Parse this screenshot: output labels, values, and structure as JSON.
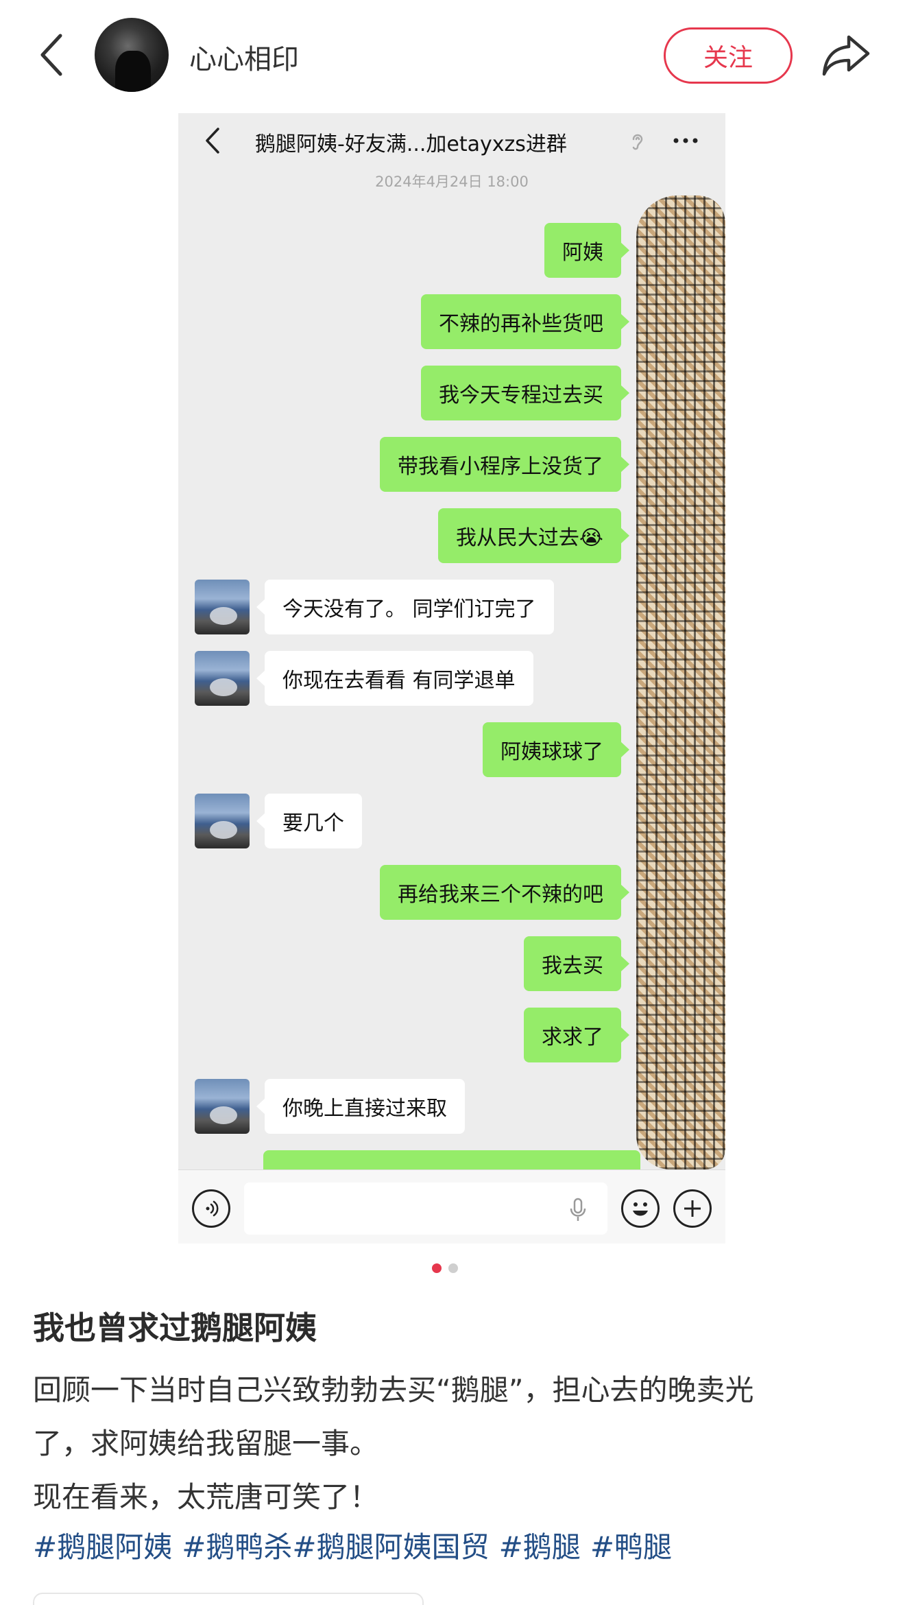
{
  "header": {
    "author_name": "心心相印",
    "follow_label": "关注"
  },
  "chat": {
    "title": "鹅腿阿姨-好友满...加etayxzs进群",
    "timestamp": "2024年4月24日 18:00",
    "messages": [
      {
        "dir": "out",
        "text": "阿姨"
      },
      {
        "dir": "out",
        "text": "不辣的再补些货吧"
      },
      {
        "dir": "out",
        "text": "我今天专程过去买"
      },
      {
        "dir": "out",
        "text": "带我看小程序上没货了"
      },
      {
        "dir": "out",
        "text": "我从民大过去😭"
      },
      {
        "dir": "in",
        "text": "今天没有了。 同学们订完了"
      },
      {
        "dir": "in",
        "text": "你现在去看看 有同学退单"
      },
      {
        "dir": "out",
        "text": "阿姨球球了"
      },
      {
        "dir": "in",
        "text": "要几个"
      },
      {
        "dir": "out",
        "text": "再给我来三个不辣的吧"
      },
      {
        "dir": "out",
        "text": "我去买"
      },
      {
        "dir": "out",
        "text": "求求了"
      },
      {
        "dir": "in",
        "text": "你晚上直接过来取"
      }
    ]
  },
  "carousel": {
    "total": 2,
    "current": 1
  },
  "post": {
    "title": "我也曾求过鹅腿阿姨",
    "body_lines": [
      "回顾一下当时自己兴致勃勃去买“鹅腿”，担心去的晚卖光",
      "了，求阿姨给我留腿一事。",
      "现在看来，太荒唐可笑了！"
    ],
    "tags": [
      "#鹅腿阿姨",
      "#鹅鸭杀",
      "#鹅腿阿姨国贸",
      "#鹅腿",
      "#鸭腿"
    ]
  },
  "colors": {
    "accent": "#e6374d",
    "bubble_out": "#95ec69",
    "bubble_in": "#ffffff",
    "chat_bg": "#ededed",
    "tag": "#234e86"
  },
  "icons": [
    "back-icon",
    "share-icon",
    "chat-back-icon",
    "ear-icon",
    "more-icon",
    "voice-icon",
    "mic-icon",
    "emoji-icon",
    "plus-icon"
  ]
}
